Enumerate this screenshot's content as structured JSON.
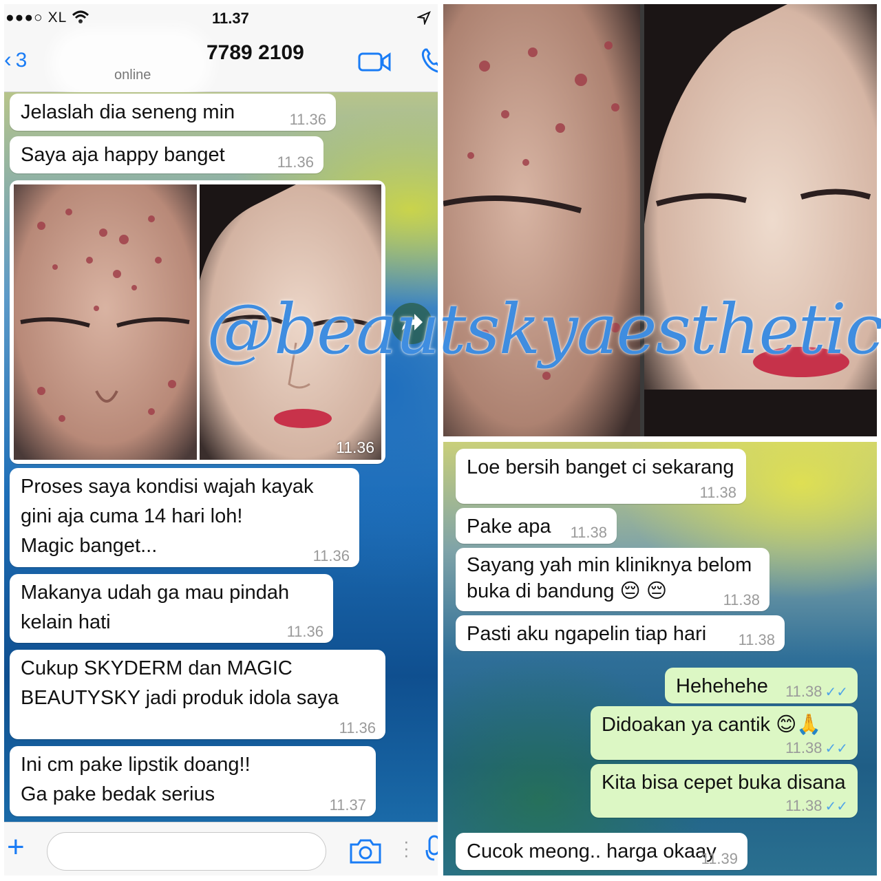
{
  "left_screen": {
    "status": {
      "signal": "●●●○ XL",
      "time": "11.37"
    },
    "header": {
      "back_count": "3",
      "contact_number": "7789 2109",
      "presence": "online"
    },
    "messages": [
      {
        "text": "Jelaslah dia seneng min",
        "time": "11.36"
      },
      {
        "text": "Saya aja happy banget",
        "time": "11.36"
      },
      {
        "text": "Proses saya kondisi wajah kayak\ngini aja cuma 14 hari loh!\nMagic banget...",
        "time": "11.36"
      },
      {
        "text": "Makanya udah ga mau pindah\nkelain hati",
        "time": "11.36"
      },
      {
        "text": "Cukup SKYDERM dan MAGIC\nBEAUTYSKY jadi produk idola saya",
        "time": "11.36"
      },
      {
        "text": "Ini cm pake lipstik doang!!\nGa pake bedak serius",
        "time": "11.37"
      }
    ],
    "photo_message": {
      "time": "11.36"
    },
    "input": {
      "placeholder": ""
    }
  },
  "right_screen": {
    "messages_in": [
      {
        "text": "Loe bersih banget ci sekarang",
        "time": "11.38"
      },
      {
        "text": "Pake apa",
        "time": "11.38"
      },
      {
        "text": "Sayang yah min kliniknya belom\nbuka di bandung 😔 😔",
        "time": "11.38"
      },
      {
        "text": "Pasti aku ngapelin tiap hari",
        "time": "11.38"
      }
    ],
    "messages_out": [
      {
        "text": "Hehehehe",
        "time": "11.38"
      },
      {
        "text": "Didoakan ya cantik 😊🙏",
        "time": "11.38"
      },
      {
        "text": "Kita bisa cepet buka disana",
        "time": "11.38"
      }
    ],
    "last_message": {
      "text": "Cucok meong.. harga okaay",
      "time": "11.39"
    }
  },
  "watermark": "@beautskyaesthetic",
  "colors": {
    "accent": "#1a7cf5",
    "outgoing_bubble": "#dcf7c4",
    "read_ticks": "#4fa3e8",
    "watermark": "#3f8de0"
  },
  "icons": [
    "wifi-icon",
    "location-arrow-icon",
    "back-chevron-icon",
    "video-call-icon",
    "phone-call-icon",
    "forward-share-icon",
    "plus-icon",
    "camera-icon",
    "microphone-icon",
    "double-check-icon"
  ]
}
